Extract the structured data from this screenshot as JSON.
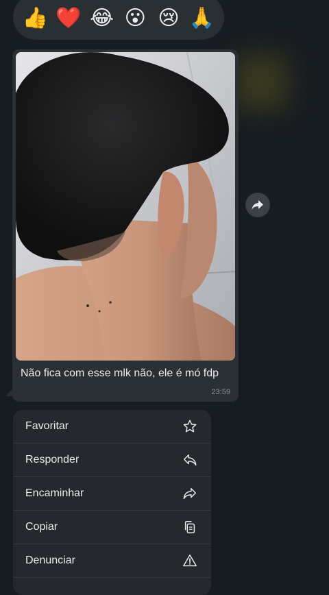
{
  "reactions": [
    {
      "name": "thumbs-up",
      "glyph": "👍"
    },
    {
      "name": "heart",
      "glyph": "❤️"
    },
    {
      "name": "tears-of-joy",
      "glyph": "😂"
    },
    {
      "name": "surprised",
      "glyph": "😮"
    },
    {
      "name": "crying",
      "glyph": "😢"
    },
    {
      "name": "folded-hands",
      "glyph": "🙏"
    }
  ],
  "message": {
    "caption": "Não fica com esse mlk não, ele é mó fdp",
    "time": "23:59",
    "image": "photo-of-person-back-of-head"
  },
  "forward_icon": "share-arrow-icon",
  "menu": {
    "items": [
      {
        "label": "Favoritar",
        "icon": "star-icon"
      },
      {
        "label": "Responder",
        "icon": "reply-icon"
      },
      {
        "label": "Encaminhar",
        "icon": "forward-icon"
      },
      {
        "label": "Copiar",
        "icon": "copy-icon"
      },
      {
        "label": "Denunciar",
        "icon": "warning-icon"
      }
    ]
  },
  "colors": {
    "background": "#171c21",
    "bubble": "#2b3034",
    "menu": "#25292d",
    "text": "#e9edef",
    "muted": "#8a9297"
  }
}
